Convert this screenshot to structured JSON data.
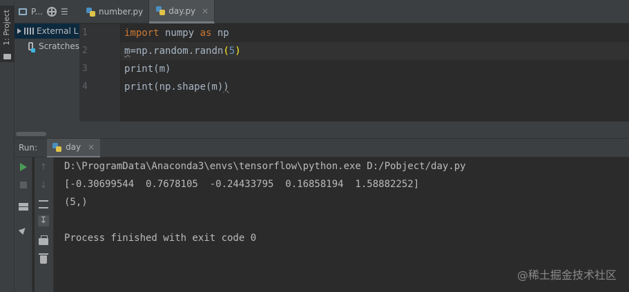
{
  "side_strip": {
    "project_tab_label": "1: Project"
  },
  "project_panel": {
    "title": "P...",
    "more": "☰",
    "items": [
      {
        "label": "External L"
      },
      {
        "label": "Scratches"
      }
    ]
  },
  "editor_tabs": [
    {
      "label": "number.py",
      "active": false
    },
    {
      "label": "day.py",
      "active": true,
      "close": "×"
    }
  ],
  "editor": {
    "line_numbers": [
      "1",
      "2",
      "3",
      "4"
    ],
    "lines": {
      "l1_kw": "import",
      "l1_mid": " numpy ",
      "l1_kw2": "as",
      "l1_end": " np",
      "l2_a": "m",
      "l2_b": "=",
      "l2_c": "np.random.randn",
      "l2_p1": "(",
      "l2_num": "5",
      "l2_p2": ")",
      "l3": "print(m)",
      "l4_a": "print(np.shape(m)",
      "l4_b": ")"
    }
  },
  "run_panel": {
    "label": "Run:",
    "tab_label": "day",
    "tab_close": "×"
  },
  "console": {
    "lines": [
      "D:\\ProgramData\\Anaconda3\\envs\\tensorflow\\python.exe D:/Pobject/day.py",
      "[-0.30699544  0.7678105  -0.24433795  0.16858194  1.58882252]",
      "(5,)",
      "",
      "Process finished with exit code 0"
    ]
  },
  "watermark": "@稀土掘金技术社区"
}
